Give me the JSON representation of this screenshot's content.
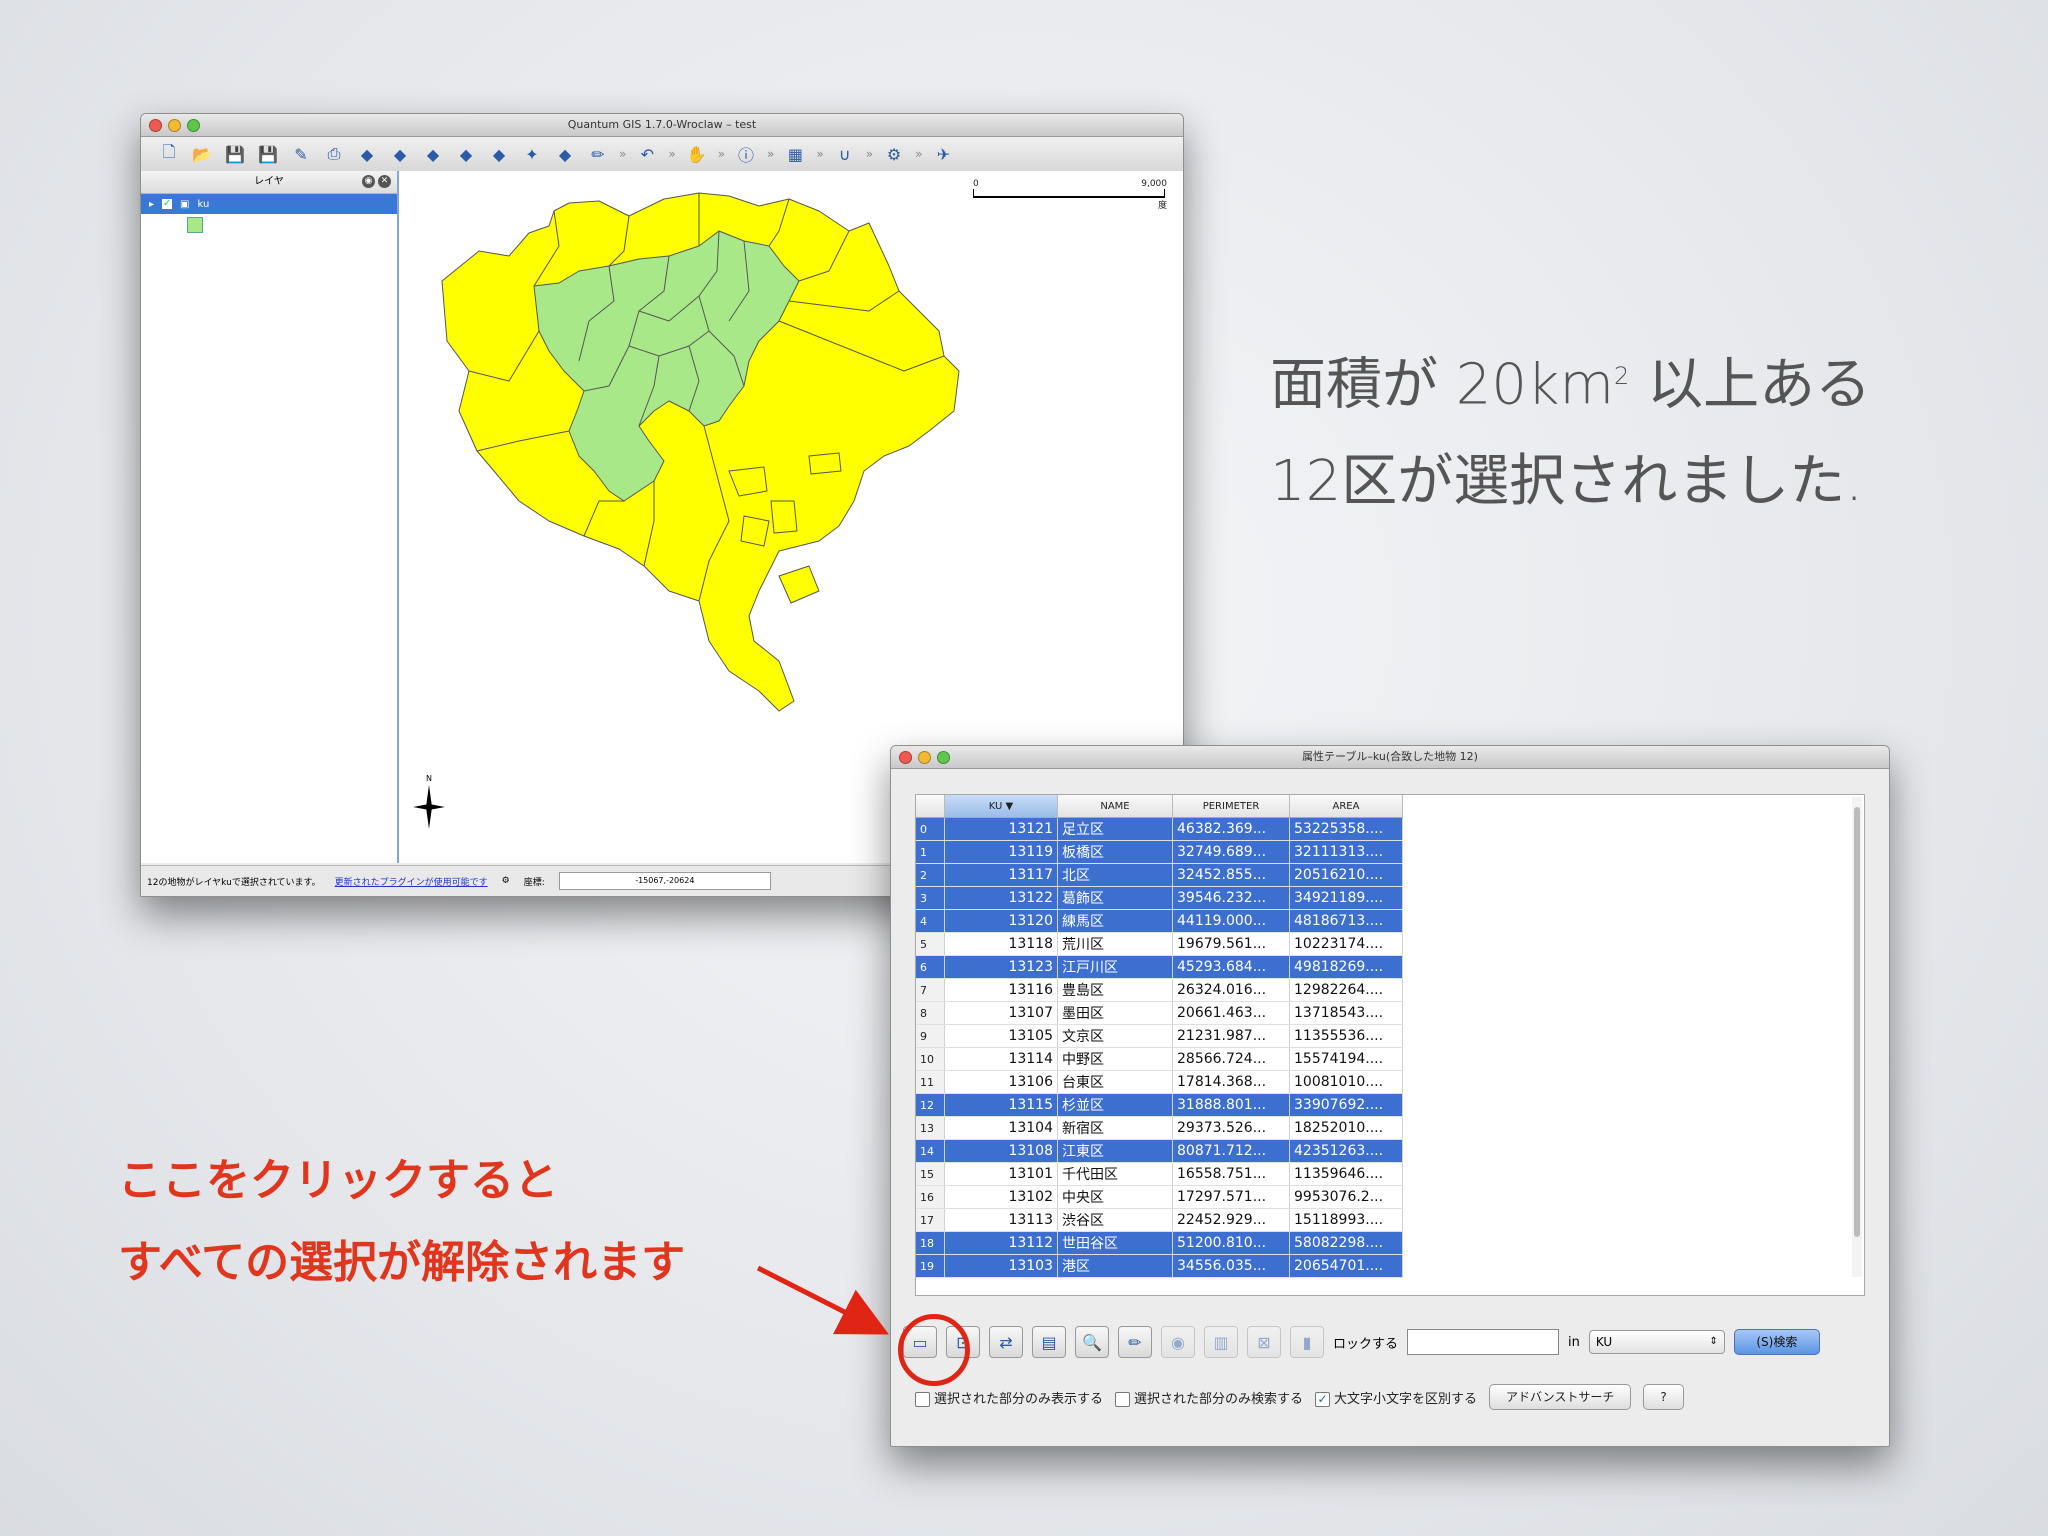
{
  "qgis": {
    "title": "Quantum GIS 1.7.0-Wroclaw – test",
    "layers_panel_title": "レイヤ",
    "layer_name": "ku",
    "status_selected": "12の地物がレイヤkuで選択されています。",
    "status_plugin_link": "更新されたプラグインが使用可能です",
    "coord_label": "座標:",
    "coord_value": "-15067,-20624",
    "scale_left": "0",
    "scale_right": "9,000",
    "scale_unit": "度",
    "north_label": "N"
  },
  "attr": {
    "title": "属性テーブル–ku(合致した地物 12)",
    "columns": [
      "KU",
      "NAME",
      "PERIMETER",
      "AREA"
    ],
    "rows": [
      {
        "n": "0",
        "ku": "13121",
        "name": "足立区",
        "per": "46382.369...",
        "area": "53225358....",
        "sel": true
      },
      {
        "n": "1",
        "ku": "13119",
        "name": "板橋区",
        "per": "32749.689...",
        "area": "32111313....",
        "sel": true
      },
      {
        "n": "2",
        "ku": "13117",
        "name": "北区",
        "per": "32452.855...",
        "area": "20516210....",
        "sel": true
      },
      {
        "n": "3",
        "ku": "13122",
        "name": "葛飾区",
        "per": "39546.232...",
        "area": "34921189....",
        "sel": true
      },
      {
        "n": "4",
        "ku": "13120",
        "name": "練馬区",
        "per": "44119.000...",
        "area": "48186713....",
        "sel": true
      },
      {
        "n": "5",
        "ku": "13118",
        "name": "荒川区",
        "per": "19679.561...",
        "area": "10223174....",
        "sel": false
      },
      {
        "n": "6",
        "ku": "13123",
        "name": "江戸川区",
        "per": "45293.684...",
        "area": "49818269....",
        "sel": true
      },
      {
        "n": "7",
        "ku": "13116",
        "name": "豊島区",
        "per": "26324.016...",
        "area": "12982264....",
        "sel": false
      },
      {
        "n": "8",
        "ku": "13107",
        "name": "墨田区",
        "per": "20661.463...",
        "area": "13718543....",
        "sel": false
      },
      {
        "n": "9",
        "ku": "13105",
        "name": "文京区",
        "per": "21231.987...",
        "area": "11355536....",
        "sel": false
      },
      {
        "n": "10",
        "ku": "13114",
        "name": "中野区",
        "per": "28566.724...",
        "area": "15574194....",
        "sel": false
      },
      {
        "n": "11",
        "ku": "13106",
        "name": "台東区",
        "per": "17814.368...",
        "area": "10081010....",
        "sel": false
      },
      {
        "n": "12",
        "ku": "13115",
        "name": "杉並区",
        "per": "31888.801...",
        "area": "33907692....",
        "sel": true
      },
      {
        "n": "13",
        "ku": "13104",
        "name": "新宿区",
        "per": "29373.526...",
        "area": "18252010....",
        "sel": false
      },
      {
        "n": "14",
        "ku": "13108",
        "name": "江東区",
        "per": "80871.712...",
        "area": "42351263....",
        "sel": true
      },
      {
        "n": "15",
        "ku": "13101",
        "name": "千代田区",
        "per": "16558.751...",
        "area": "11359646....",
        "sel": false
      },
      {
        "n": "16",
        "ku": "13102",
        "name": "中央区",
        "per": "17297.571...",
        "area": "9953076.2...",
        "sel": false
      },
      {
        "n": "17",
        "ku": "13113",
        "name": "渋谷区",
        "per": "22452.929...",
        "area": "15118993....",
        "sel": false
      },
      {
        "n": "18",
        "ku": "13112",
        "name": "世田谷区",
        "per": "51200.810...",
        "area": "58082298....",
        "sel": true
      },
      {
        "n": "19",
        "ku": "13103",
        "name": "港区",
        "per": "34556.035...",
        "area": "20654701....",
        "sel": true
      }
    ],
    "lock_label": "ロックする",
    "in_label": "in",
    "field_select": "KU",
    "search_button": "(S)検索",
    "opt_show_selected": "選択された部分のみ表示する",
    "opt_search_selected": "選択された部分のみ検索する",
    "opt_case": "大文字小文字を区別する",
    "advanced_button": "アドバンストサーチ",
    "help_button": "?"
  },
  "caption": {
    "line1a": "面積が 20km",
    "line1_sup": "2",
    "line1b": " 以上ある",
    "line2": "12区が選択されました."
  },
  "note": {
    "line1": "ここをクリックすると",
    "line2": "すべての選択が解除されます"
  },
  "colors": {
    "selected_fill": "#a9e889",
    "unselected_fill": "#ffff00",
    "annotation": "#e0361e",
    "selection_row": "#3d6fd0"
  }
}
